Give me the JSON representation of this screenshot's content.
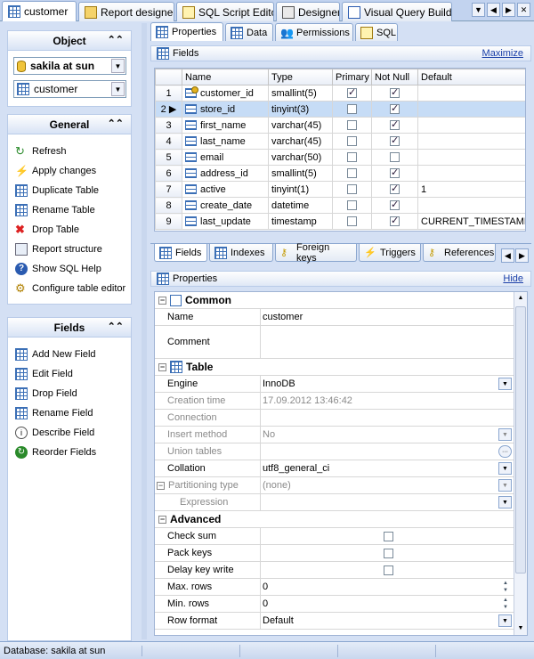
{
  "top_tabs": [
    {
      "label": "customer",
      "active": true
    },
    {
      "label": "Report designer"
    },
    {
      "label": "SQL Script Editor"
    },
    {
      "label": "Designer"
    },
    {
      "label": "Visual Query Builder"
    }
  ],
  "object_panel": {
    "title": "Object",
    "database": "sakila at sun",
    "table": "customer"
  },
  "general_panel": {
    "title": "General",
    "items": [
      "Refresh",
      "Apply changes",
      "Duplicate Table",
      "Rename Table",
      "Drop Table",
      "Report structure",
      "Show SQL Help",
      "Configure table editor"
    ]
  },
  "fields_panel": {
    "title": "Fields",
    "items": [
      "Add New Field",
      "Edit Field",
      "Drop Field",
      "Rename Field",
      "Describe Field",
      "Reorder Fields"
    ]
  },
  "editor_tabs": [
    "Properties",
    "Data",
    "Permissions",
    "SQL"
  ],
  "fields_section": {
    "title": "Fields",
    "action": "Maximize"
  },
  "fields_grid": {
    "columns": [
      "Name",
      "Type",
      "Primary",
      "Not Null",
      "Default"
    ],
    "rows": [
      {
        "num": "1",
        "name": "customer_id",
        "type": "smallint(5)",
        "primary": true,
        "not_null": true,
        "default": ""
      },
      {
        "num": "2",
        "name": "store_id",
        "type": "tinyint(3)",
        "primary": false,
        "not_null": true,
        "default": ""
      },
      {
        "num": "3",
        "name": "first_name",
        "type": "varchar(45)",
        "primary": false,
        "not_null": true,
        "default": ""
      },
      {
        "num": "4",
        "name": "last_name",
        "type": "varchar(45)",
        "primary": false,
        "not_null": true,
        "default": ""
      },
      {
        "num": "5",
        "name": "email",
        "type": "varchar(50)",
        "primary": false,
        "not_null": false,
        "default": ""
      },
      {
        "num": "6",
        "name": "address_id",
        "type": "smallint(5)",
        "primary": false,
        "not_null": true,
        "default": ""
      },
      {
        "num": "7",
        "name": "active",
        "type": "tinyint(1)",
        "primary": false,
        "not_null": true,
        "default": "1"
      },
      {
        "num": "8",
        "name": "create_date",
        "type": "datetime",
        "primary": false,
        "not_null": true,
        "default": ""
      },
      {
        "num": "9",
        "name": "last_update",
        "type": "timestamp",
        "primary": false,
        "not_null": true,
        "default": "CURRENT_TIMESTAMP"
      }
    ]
  },
  "grid_tabs": [
    "Fields",
    "Indexes",
    "Foreign keys",
    "Triggers",
    "References"
  ],
  "properties_section": {
    "title": "Properties",
    "action": "Hide"
  },
  "properties": {
    "common_title": "Common",
    "name_label": "Name",
    "name_value": "customer",
    "comment_label": "Comment",
    "comment_value": "",
    "table_title": "Table",
    "engine_label": "Engine",
    "engine_value": "InnoDB",
    "creation_time_label": "Creation time",
    "creation_time_value": "17.09.2012 13:46:42",
    "connection_label": "Connection",
    "connection_value": "",
    "insert_method_label": "Insert method",
    "insert_method_value": "No",
    "union_tables_label": "Union tables",
    "union_tables_value": "",
    "collation_label": "Collation",
    "collation_value": "utf8_general_ci",
    "partitioning_label": "Partitioning type",
    "partitioning_value": "(none)",
    "expression_label": "Expression",
    "expression_value": "",
    "advanced_title": "Advanced",
    "check_sum_label": "Check sum",
    "pack_keys_label": "Pack keys",
    "delay_key_write_label": "Delay key write",
    "max_rows_label": "Max. rows",
    "max_rows_value": "0",
    "min_rows_label": "Min. rows",
    "min_rows_value": "0",
    "row_format_label": "Row format",
    "row_format_value": "Default"
  },
  "status": {
    "text": "Database: sakila at sun"
  }
}
